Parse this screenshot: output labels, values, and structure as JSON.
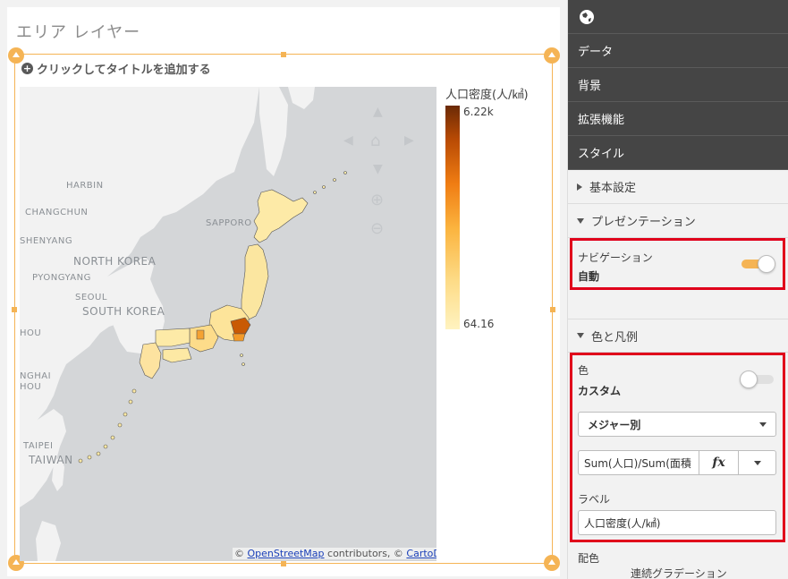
{
  "sheet": {
    "title": "エリア レイヤー",
    "add_title": "クリックしてタイトルを追加する"
  },
  "map": {
    "cities": [
      "HARBIN",
      "CHANGCHUN",
      "SHENYANG",
      "PYONGYANG",
      "SEOUL",
      "SAPPORO",
      "HOU",
      "NGHAI",
      "HOU",
      "TAIPEI"
    ],
    "countries": [
      "NORTH KOREA",
      "SOUTH KOREA",
      "TAIWAN"
    ],
    "attribution": {
      "prefix": "©",
      "osm": "OpenStreetMap",
      "middle": "contributors, ©",
      "carto": "CartoDB"
    },
    "land_color": "#f2f2f2",
    "water_color": "#d4d6d8"
  },
  "legend": {
    "title": "人口密度(人/㎢)",
    "max": "6.22k",
    "min": "64.16"
  },
  "panel": {
    "tabs": [
      "データ",
      "背景",
      "拡張機能",
      "スタイル"
    ],
    "sections": {
      "basic": "基本設定",
      "presentation": "プレゼンテーション",
      "color_legend": "色と凡例"
    },
    "navigation": {
      "label": "ナビゲーション",
      "value": "自動",
      "on": true
    },
    "color": {
      "label": "色",
      "value": "カスタム",
      "on": false,
      "mode": "メジャー別",
      "expression": "Sum(人口)/Sum(面積",
      "fx": "fx"
    },
    "label": {
      "label": "ラベル",
      "value": "人口密度(人/㎢)"
    },
    "palette": {
      "label": "配色",
      "value": "連続グラデーション"
    }
  },
  "colors": {
    "accent": "#f5b455",
    "highlight": "#e0001b",
    "dark_nav": "#454545"
  }
}
